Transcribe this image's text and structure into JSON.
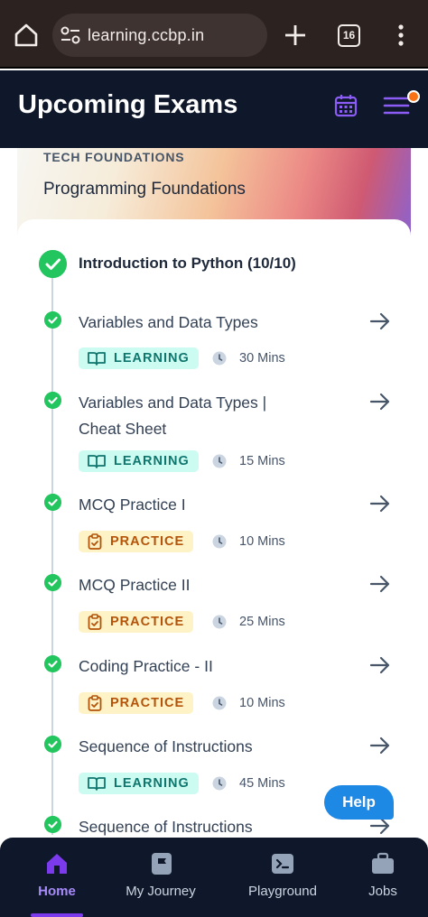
{
  "browser": {
    "url": "learning.ccbp.in",
    "tab_count": "16"
  },
  "header": {
    "title": "Upcoming Exams"
  },
  "course": {
    "tag": "TECH FOUNDATIONS",
    "name": "Programming Foundations"
  },
  "section": {
    "title": "Introduction to Python (10/10)"
  },
  "items": [
    {
      "name": "Variables and Data Types",
      "type": "LEARNING",
      "duration": "30 Mins"
    },
    {
      "name": "Variables and Data Types | Cheat Sheet",
      "type": "LEARNING",
      "duration": "15 Mins"
    },
    {
      "name": "MCQ Practice I",
      "type": "PRACTICE",
      "duration": "10 Mins"
    },
    {
      "name": "MCQ Practice II",
      "type": "PRACTICE",
      "duration": "25 Mins"
    },
    {
      "name": "Coding Practice - II",
      "type": "PRACTICE",
      "duration": "10 Mins"
    },
    {
      "name": "Sequence of Instructions",
      "type": "LEARNING",
      "duration": "45 Mins"
    },
    {
      "name": "Sequence of Instructions"
    }
  ],
  "help": {
    "label": "Help"
  },
  "nav": {
    "home": "Home",
    "journey": "My Journey",
    "playground": "Playground",
    "jobs": "Jobs"
  },
  "colors": {
    "accent": "#7c3aed",
    "complete": "#22c55e",
    "learning_bg": "#ccfbf1",
    "practice_bg": "#fef3c7",
    "help": "#1e88e5",
    "notification": "#f97316"
  },
  "icons": {
    "home": "home-icon",
    "site_settings": "tune-icon",
    "new_tab": "plus-icon",
    "more": "more-vertical-icon",
    "calendar": "calendar-icon",
    "menu": "menu-icon",
    "learning": "book-open-icon",
    "practice": "clipboard-check-icon",
    "duration": "clock-icon",
    "open": "arrow-right-icon",
    "journey": "flag-icon",
    "playground": "terminal-icon",
    "jobs": "briefcase-icon"
  }
}
